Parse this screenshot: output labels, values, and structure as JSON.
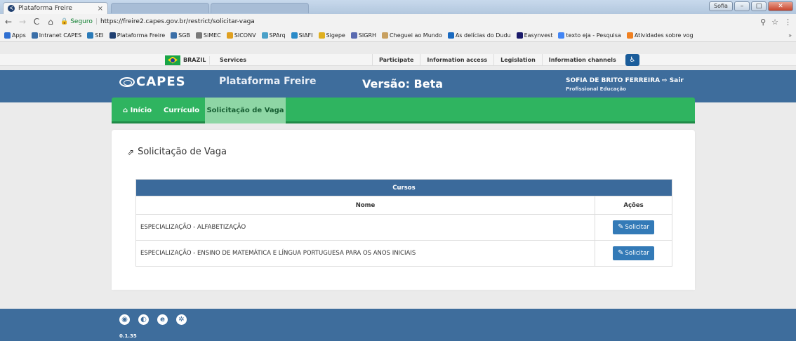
{
  "browser": {
    "tab_active_title": "Plataforma Freire",
    "tab_close": "×",
    "window_user": "Sofia",
    "url_secure_label": "Seguro",
    "url": "https://freire2.capes.gov.br/restrict/solicitar-vaga",
    "bookmarks": [
      {
        "label": "Apps",
        "color": "#2f6fd1"
      },
      {
        "label": "Intranet CAPES",
        "color": "#3b6fa8"
      },
      {
        "label": "SEI",
        "color": "#2a7ab8"
      },
      {
        "label": "Plataforma Freire",
        "color": "#1f3f70"
      },
      {
        "label": "SGB",
        "color": "#3b6fa8"
      },
      {
        "label": "SiMEC",
        "color": "#7a7a7a"
      },
      {
        "label": "SICONV",
        "color": "#e0a020"
      },
      {
        "label": "SPArq",
        "color": "#4aa0c8"
      },
      {
        "label": "SIAFI",
        "color": "#2a8ac8"
      },
      {
        "label": "Sigepe",
        "color": "#e0b020"
      },
      {
        "label": "SIGRH",
        "color": "#5a6ab0"
      },
      {
        "label": "Cheguei ao Mundo",
        "color": "#c8a060"
      },
      {
        "label": "As delícias do Dudu",
        "color": "#1a6ac0"
      },
      {
        "label": "Easynvest",
        "color": "#1a1a6a"
      },
      {
        "label": "texto eja - Pesquisa",
        "color": "#4285f4"
      },
      {
        "label": "Atividades sobre vog",
        "color": "#f08020"
      }
    ],
    "bookmarks_more": "»"
  },
  "govbar": {
    "brazil": "BRAZIL",
    "services": "Services",
    "links": [
      "Participate",
      "Information access",
      "Legislation",
      "Information channels"
    ]
  },
  "header": {
    "logo": "CAPES",
    "platform": "Plataforma Freire",
    "version_label": "Versão: Beta",
    "user_name": "SOFIA DE BRITO FERREIRA",
    "user_role": "Profissional Educação",
    "logout": "Sair"
  },
  "nav": {
    "inicio": "Início",
    "curriculo": "Currículo",
    "solicitacao": "Solicitação de Vaga"
  },
  "main": {
    "heading": "Solicitação de Vaga",
    "table_caption": "Cursos",
    "col_nome": "Nome",
    "col_acoes": "Ações",
    "rows": [
      {
        "nome": "ESPECIALIZAÇÃO - ALFABETIZAÇÃO",
        "action": "Solicitar"
      },
      {
        "nome": "ESPECIALIZAÇÃO - ENSINO DE MATEMÁTICA E LÍNGUA PORTUGUESA PARA OS ANOS INICIAIS",
        "action": "Solicitar"
      }
    ]
  },
  "footer": {
    "version": "0.1.35"
  }
}
